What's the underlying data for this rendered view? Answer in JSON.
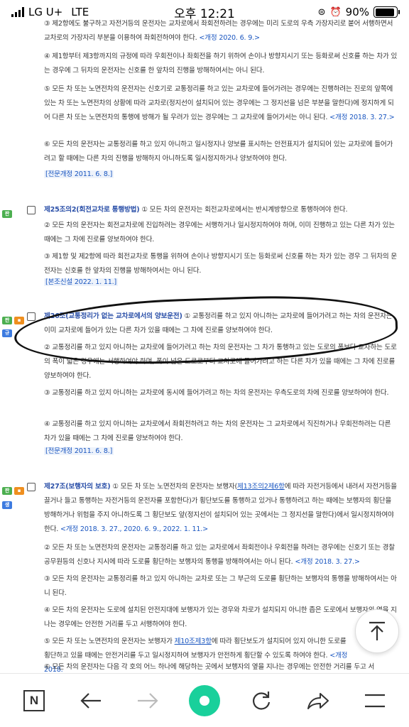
{
  "status_bar": {
    "carrier": "LG U+",
    "network": "LTE",
    "time": "오후 12:21",
    "battery": "90%",
    "battery_level": 0.9
  },
  "paragraphs": [
    {
      "text": "③ 제2항에도 불구하고 자전거등의 운전자는 교차로에서 좌회전하려는 경우에는 미리 도로의 우측 가장자리로 붙어 서행하면서 교차로의 가장자리 부분을 이용하여 좌회전하여야 한다.",
      "amend": "<개정 2020. 6. 9.>"
    },
    {
      "text": "④ 제1항부터 제3항까지의 규정에 따라 우회전이나 좌회전을 하기 위하여 손이나 방향지시기 또는 등화로써 신호를 하는 차가 있는 경우에 그 뒤차의 운전자는 신호를 한 앞차의 진행을 방해하여서는 아니 된다.",
      "amend": ""
    },
    {
      "text": "⑤ 모든 차 또는 노면전차의 운전자는 신호기로 교통정리를 하고 있는 교차로에 들어가려는 경우에는 진행하려는 진로의 앞쪽에 있는 차 또는 노면전차의 상황에 따라 교차로(정지선이 설치되어 있는 경우에는 그 정지선을 넘은 부분을 말한다)에 정지하게 되어 다른 차 또는 노면전차의 통행에 방해가 될 우려가 있는 경우에는 그 교차로에 들어가서는 아니 된다.",
      "amend": "<개정 2018. 3. 27.>"
    },
    {
      "text": "⑥ 모든 차의 운전자는 교통정리를 하고 있지 아니하고 일시정지나 양보를 표시하는 안전표지가 설치되어 있는 교차로에 들어가려고 할 때에는 다른 차의 진행을 방해하지 아니하도록 일시정지하거나 양보하여야 한다.",
      "amend": ""
    }
  ],
  "history_1": "[전문개정 2011. 6. 8.]",
  "article_25_2": {
    "title": "제25조의2(회전교차로 통행방법)",
    "p1": "① 모든 차의 운전자는 회전교차로에서는 반시계방향으로 통행하여야 한다.",
    "p2": "② 모든 차의 운전자는 회전교차로에 진입하려는 경우에는 서행하거나 일시정지하여야 하며, 이미 진행하고 있는 다른 차가 있는 때에는 그 차에 진로를 양보하여야 한다.",
    "p3": "③ 제1항 및 제2항에 따라 회전교차로 통행을 위하여 손이나 방향지시기 또는 등화로써 신호를 하는 차가 있는 경우 그 뒤차의 운전자는 신호를 한 앞차의 진행을 방해하여서는 아니 된다.",
    "history": "[본조신설 2022. 1. 11.]"
  },
  "article_26": {
    "title": "제26조(교통정리가 없는 교차로에서의 양보운전)",
    "p1": "① 교통정리를 하고 있지 아니하는 교차로에 들어가려고 하는 차의 운전자는 이미 교차로에 들어가 있는 다른 차가 있을 때에는 그 차에 진로를 양보하여야 한다.",
    "p2": "② 교통정리를 하고 있지 아니하는 교차로에 들어가려고 하는 차의 운전자는 그 차가 통행하고 있는 도로의 폭보다 교차하는 도로의 폭이 넓은 경우에는 서행하여야 하며, 폭이 넓은 도로로부터 교차로에 들어가려고 하는 다른 차가 있을 때에는 그 차에 진로를 양보하여야 한다.",
    "p3": "③ 교통정리를 하고 있지 아니하는 교차로에 동시에 들어가려고 하는 차의 운전자는 우측도로의 차에 진로를 양보하여야 한다.",
    "p4": "④ 교통정리를 하고 있지 아니하는 교차로에서 좌회전하려고 하는 차의 운전자는 그 교차로에서 직진하거나 우회전하려는 다른 차가 있을 때에는 그 차에 진로를 양보하여야 한다.",
    "history": "[전문개정 2011. 6. 8.]"
  },
  "article_27": {
    "title": "제27조(보행자의 보호)",
    "p1_a": "① 모든 차 또는 노면전차의 운전자는 보행자(",
    "p1_link": "제13조의2제6항",
    "p1_b": "에 따라 자전거등에서 내려서 자전거등을 끌거나 들고 통행하는 자전거등의 운전자를 포함한다)가 횡단보도를 통행하고 있거나 통행하려고 하는 때에는 보행자의 횡단을 방해하거나 위험을 주지 아니하도록 그 횡단보도 앞(정지선이 설치되어 있는 곳에서는 그 정지선을 말한다)에서 일시정지하여야 한다.",
    "p1_amend": "<개정 2018. 3. 27., 2020. 6. 9., 2022. 1. 11.>",
    "p2": "② 모든 차 또는 노면전차의 운전자는 교통정리를 하고 있는 교차로에서 좌회전이나 우회전을 하려는 경우에는 신호기 또는 경찰공무원등의 신호나 지시에 따라 도로를 횡단하는 보행자의 통행을 방해하여서는 아니 된다.",
    "p2_amend": "<개정 2018. 3. 27.>",
    "p3": "③ 모든 차의 운전자는 교통정리를 하고 있지 아니하는 교차로 또는 그 부근의 도로를 횡단하는 보행자의 통행을 방해하여서는 아니 된다.",
    "p4": "④ 모든 차의 운전자는 도로에 설치된 안전지대에 보행자가 있는 경우와 차로가 설치되지 아니한 좁은 도로에서 보행자의 옆을 지나는 경우에는 안전한 거리를 두고 서행하여야 한다.",
    "p5_a": "⑤ 모든 차 또는 노면전차의 운전자는 보행자가 ",
    "p5_link": "제10조제3항",
    "p5_b": "에 따라 횡단보도가 설치되어 있지 아니한 도로를 횡단하고 있을 때에는 안전거리를 두고 일시정지하여 보행자가 안전하게 횡단할 수 있도록 하여야 한다.",
    "p5_amend": "<개정 2018.",
    "p6": "⑥ 모든 차의 운전자는 다음 각 호의 어느 하나에 해당하는 곳에서 보행자의 옆을 지나는 경우에는 안전한 거리를 두고 서"
  },
  "badges": {
    "b1": "판",
    "b2": "판",
    "b3": "판",
    "b4": "규",
    "b5": "판",
    "b6": "판",
    "b7": "생"
  },
  "toolbar": {
    "n_label": "N"
  }
}
